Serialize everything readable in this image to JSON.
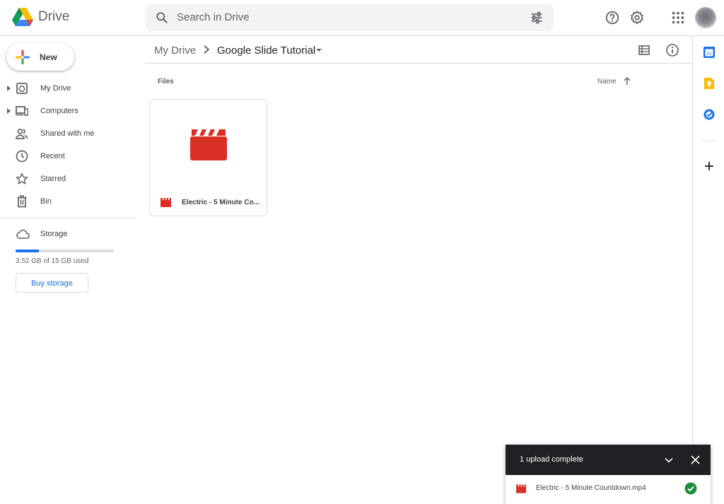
{
  "header": {
    "brand": "Drive",
    "search_placeholder": "Search in Drive"
  },
  "sidebar": {
    "new_label": "New",
    "items": [
      {
        "label": "My Drive",
        "icon": "my-drive-icon"
      },
      {
        "label": "Computers",
        "icon": "computers-icon"
      },
      {
        "label": "Shared with me",
        "icon": "shared-icon"
      },
      {
        "label": "Recent",
        "icon": "clock-icon"
      },
      {
        "label": "Starred",
        "icon": "star-icon"
      },
      {
        "label": "Bin",
        "icon": "trash-icon"
      }
    ],
    "storage": {
      "label": "Storage",
      "used_text": "3.52 GB of 15 GB used",
      "used_fraction": 0.235,
      "buy_label": "Buy storage"
    }
  },
  "breadcrumb": {
    "root": "My Drive",
    "current": "Google Slide Tutorial"
  },
  "files": {
    "section_label": "Files",
    "sort_label": "Name",
    "items": [
      {
        "name": "Electric - 5 Minute Co..."
      }
    ]
  },
  "upload": {
    "title": "1 upload complete",
    "file_name": "Electric - 5 Minute Countdown.mp4"
  },
  "colors": {
    "accent": "#1a73e8",
    "video_red": "#d93025",
    "success_green": "#1e8e3e"
  }
}
